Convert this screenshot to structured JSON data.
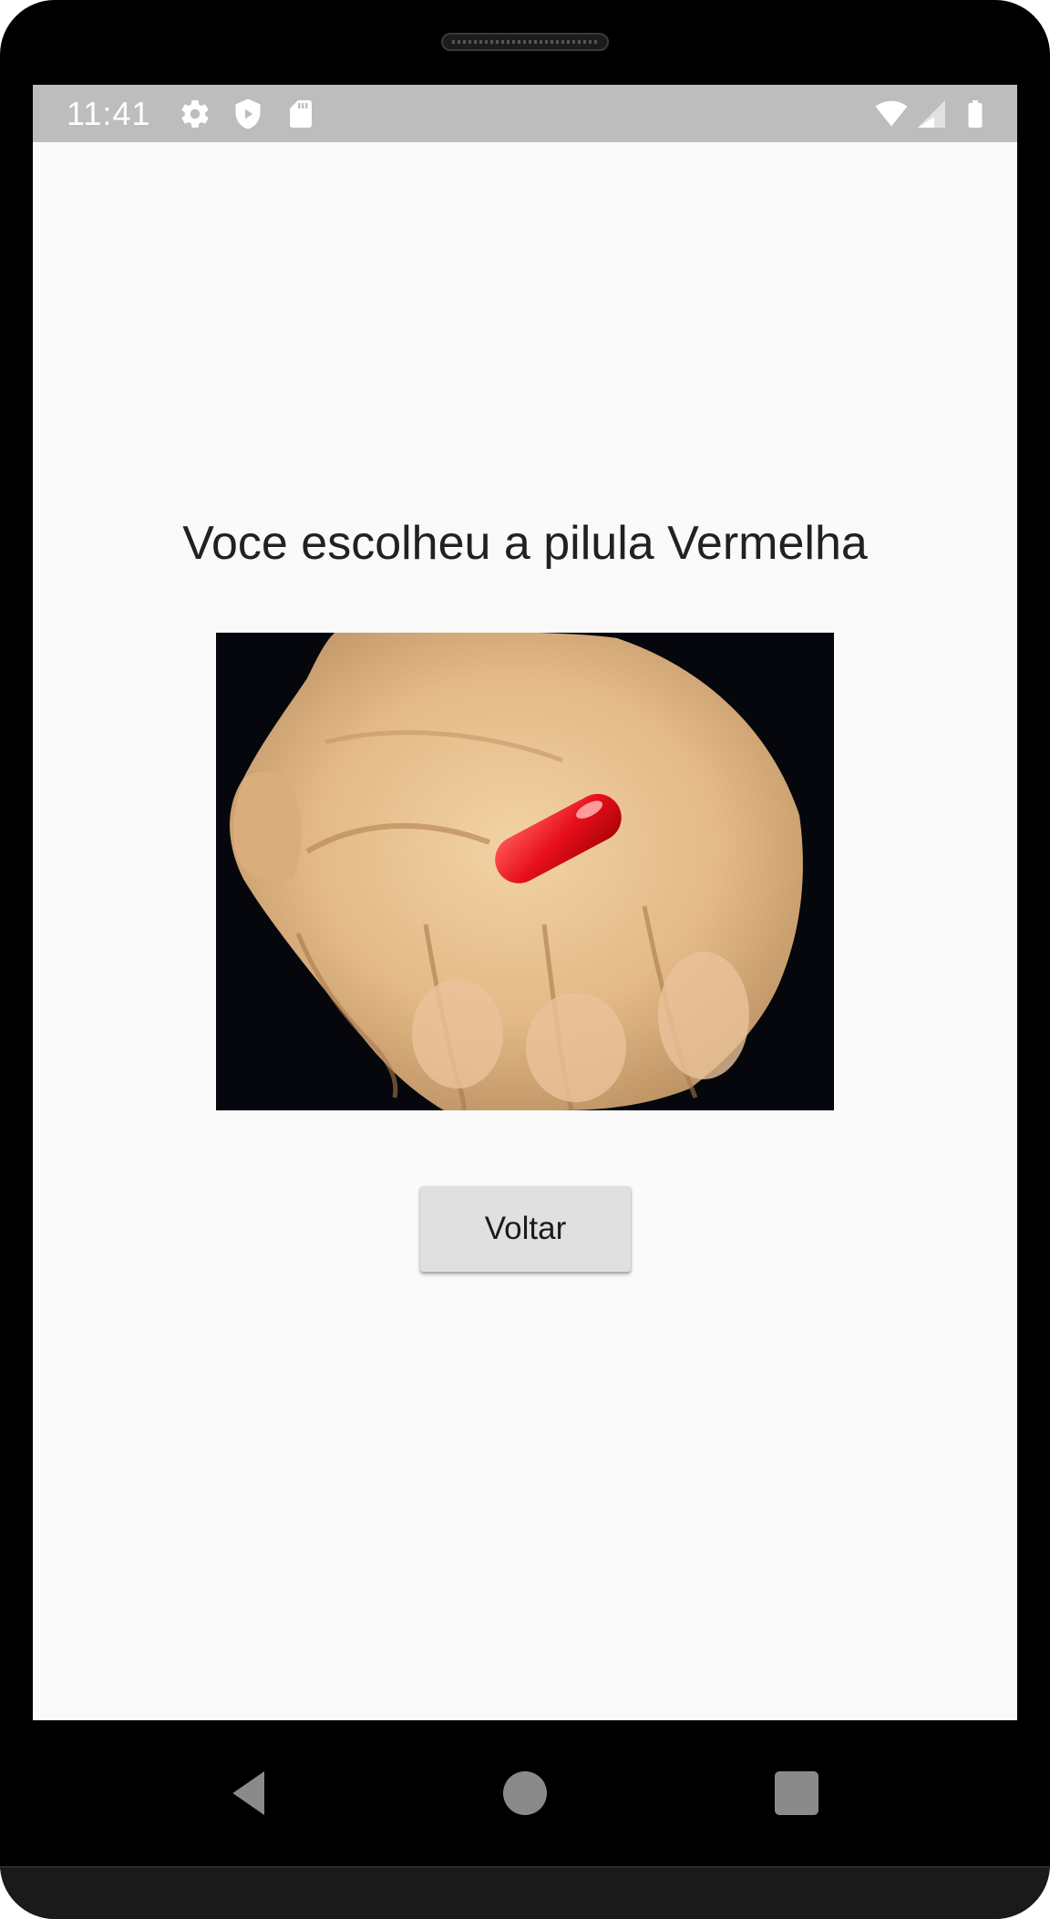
{
  "status_bar": {
    "time": "11:41",
    "left_icons": [
      "gear-icon",
      "shield-icon",
      "sd-card-icon"
    ],
    "right_icons": [
      "wifi-icon",
      "cell-signal-icon",
      "battery-icon"
    ]
  },
  "screen": {
    "message": "Voce escolheu a pilula  Vermelha",
    "image": {
      "icon": "red-pill-in-hand-image"
    },
    "back_button_label": "Voltar"
  },
  "nav_bar": {
    "buttons": [
      "back-nav-icon",
      "home-nav-icon",
      "recents-nav-icon"
    ]
  },
  "colors": {
    "status_bar_bg": "#bdbdbd",
    "screen_bg": "#fafafa",
    "button_bg": "#e0e0e0",
    "text": "#212121",
    "pill_red": "#e8101a",
    "frame": "#000000"
  }
}
